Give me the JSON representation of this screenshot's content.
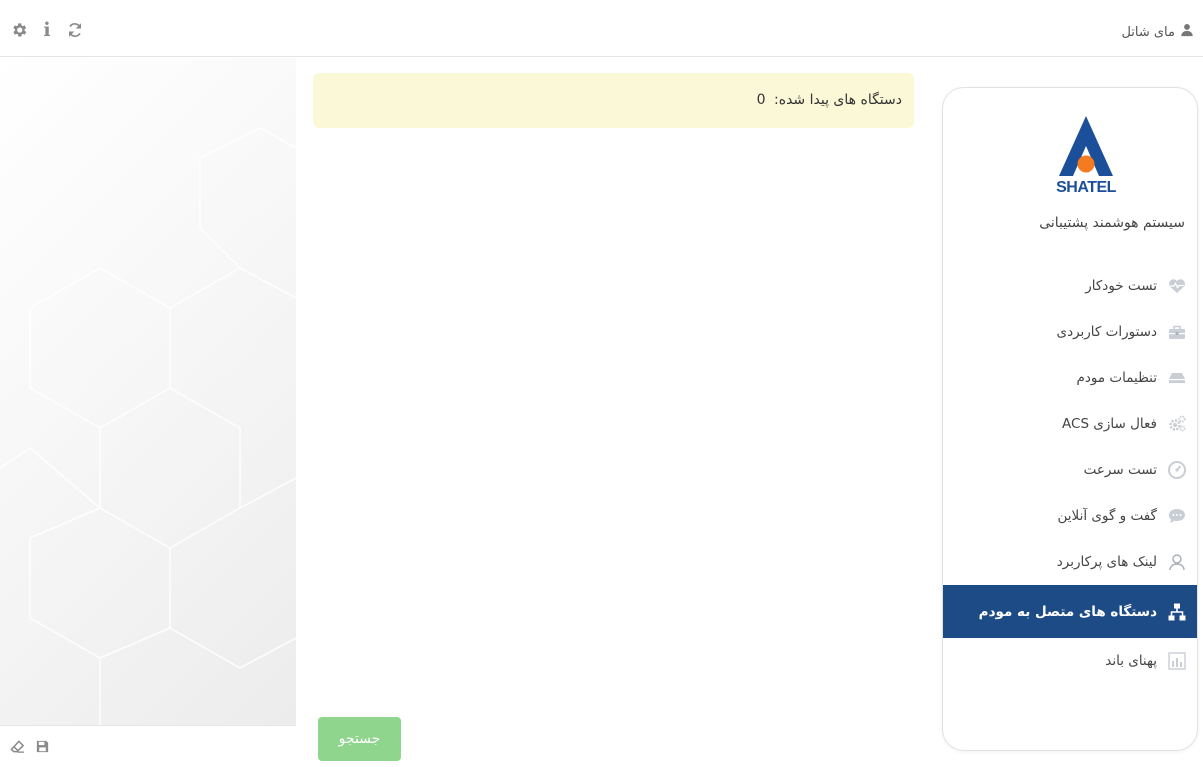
{
  "header": {
    "account_label": "مای شاتل",
    "icons": [
      "settings-icon",
      "info-icon",
      "refresh-icon"
    ]
  },
  "alert": {
    "label": "دستگاه های پیدا شده:",
    "count": "0",
    "background": "#fbf8d7"
  },
  "search_button": {
    "label": "جستجو",
    "color": "#8fd58d"
  },
  "footer_icons": [
    "eraser-icon",
    "save-icon"
  ],
  "sidebar": {
    "logo_text": "SHATEL",
    "system_title": "سیستم هوشمند پشتیبانی",
    "active_color": "#1d4b86",
    "items": [
      {
        "label": "تست خودکار",
        "icon": "heartbeat-icon"
      },
      {
        "label": "دستورات کاربردی",
        "icon": "toolbox-icon"
      },
      {
        "label": "تنظیمات مودم",
        "icon": "modem-icon"
      },
      {
        "label": "فعال سازی ACS",
        "icon": "gears-icon"
      },
      {
        "label": "تست سرعت",
        "icon": "speedometer-icon"
      },
      {
        "label": "گفت و گوی آنلاین",
        "icon": "chat-icon"
      },
      {
        "label": "لینک های پرکاربرد",
        "icon": "user-outline-icon"
      },
      {
        "label": "دستگاه های متصل به مودم",
        "icon": "network-icon",
        "active": true
      },
      {
        "label": "پهنای باند",
        "icon": "bar-chart-icon"
      }
    ]
  }
}
